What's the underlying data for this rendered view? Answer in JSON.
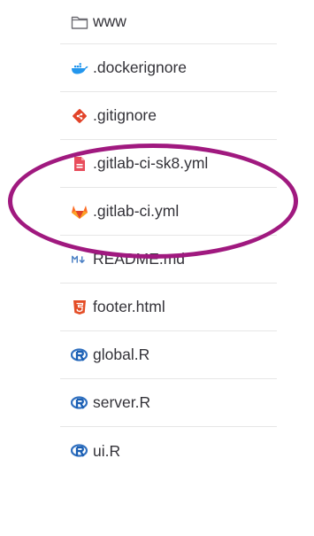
{
  "files": [
    {
      "name": "www",
      "icon": "folder-icon"
    },
    {
      "name": ".dockerignore",
      "icon": "docker-icon"
    },
    {
      "name": ".gitignore",
      "icon": "git-icon"
    },
    {
      "name": ".gitlab-ci-sk8.yml",
      "icon": "file-error-icon"
    },
    {
      "name": ".gitlab-ci.yml",
      "icon": "gitlab-icon"
    },
    {
      "name": "README.md",
      "icon": "markdown-icon"
    },
    {
      "name": "footer.html",
      "icon": "html5-icon"
    },
    {
      "name": "global.R",
      "icon": "r-icon"
    },
    {
      "name": "server.R",
      "icon": "r-icon"
    },
    {
      "name": "ui.R",
      "icon": "r-icon"
    }
  ],
  "colors": {
    "highlight": "#a0197f",
    "text": "#333238",
    "divider": "#e6e6e6"
  }
}
